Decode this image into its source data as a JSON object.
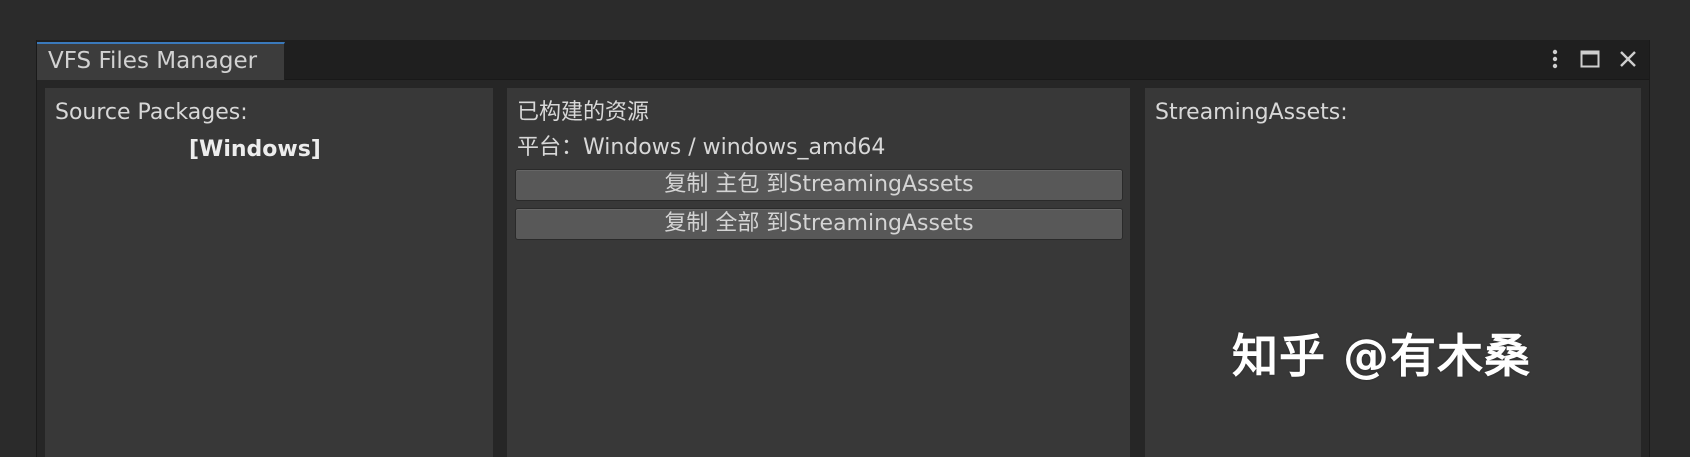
{
  "window": {
    "tab_title": "VFS Files Manager"
  },
  "source_panel": {
    "title": "Source Packages:",
    "selected_platform": "[Windows]"
  },
  "built_panel": {
    "title": "已构建的资源",
    "platform_line": "平台：Windows / windows_amd64",
    "copy_main_button": "复制 主包 到StreamingAssets",
    "copy_all_button": "复制 全部 到StreamingAssets"
  },
  "streaming_panel": {
    "title": "StreamingAssets:"
  },
  "watermark": {
    "text": "知乎 @有木桑"
  },
  "icons": {
    "menu": "vertical-dots-icon",
    "maximize": "maximize-icon",
    "close": "close-icon"
  },
  "colors": {
    "accent_tab_top": "#3a79bb",
    "panel_bg": "#383838",
    "button_bg": "#585858"
  }
}
